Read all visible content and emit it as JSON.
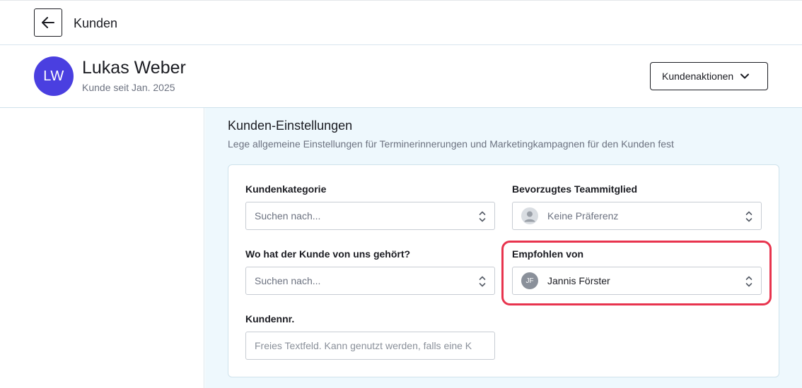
{
  "topbar": {
    "title": "Kunden",
    "back_icon": "arrow-left-icon"
  },
  "client": {
    "initials": "LW",
    "name": "Lukas Weber",
    "subtitle": "Kunde seit Jan. 2025",
    "avatar_color": "#4a3fe0"
  },
  "actions": {
    "label": "Kundenaktionen",
    "icon": "chevron-down-icon"
  },
  "section": {
    "title": "Kunden-Einstellungen",
    "description": "Lege allgemeine Einstellungen für Terminerinnerungen und Marketingkampagnen für den Kunden fest"
  },
  "fields": {
    "category": {
      "label": "Kundenkategorie",
      "placeholder": "Suchen nach..."
    },
    "team_member": {
      "label": "Bevorzugtes Teammitglied",
      "value": "Keine Präferenz"
    },
    "source": {
      "label": "Wo hat der Kunde von uns gehört?",
      "placeholder": "Suchen nach..."
    },
    "referred_by": {
      "label": "Empfohlen von",
      "initials": "JF",
      "value": "Jannis Förster"
    },
    "customer_no": {
      "label": "Kundennr.",
      "placeholder": "Freies Textfeld. Kann genutzt werden, falls eine K"
    }
  },
  "colors": {
    "accent": "#4a3fe0",
    "highlight": "#e8344e",
    "panel_bg": "#eef8fd"
  }
}
